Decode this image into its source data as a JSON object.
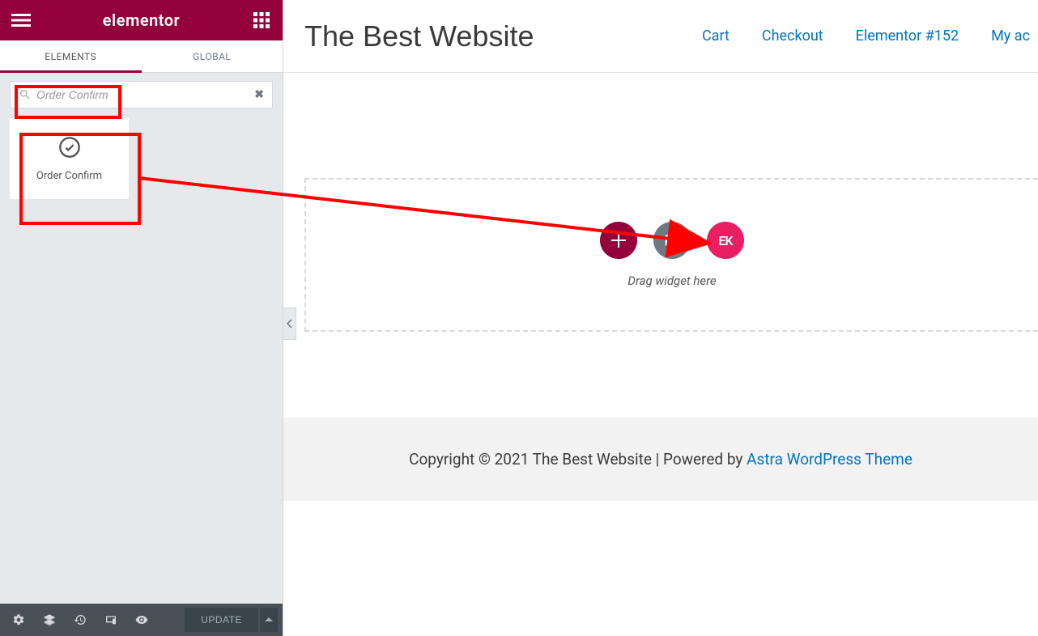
{
  "sidebar": {
    "logo": "elementor",
    "tabs": {
      "elements": "ELEMENTS",
      "global": "GLOBAL"
    },
    "search": {
      "value": "Order Confirm",
      "clear_glyph": "✖"
    },
    "widget": {
      "label": "Order Confirm"
    },
    "footer": {
      "update_label": "UPDATE"
    }
  },
  "preview": {
    "site_title": "The Best Website",
    "nav": [
      {
        "label": "Cart"
      },
      {
        "label": "Checkout"
      },
      {
        "label": "Elementor #152"
      },
      {
        "label": "My ac"
      }
    ],
    "drag_hint": "Drag widget here",
    "add_buttons": {
      "ek_label": "EK"
    },
    "footer_text": "Copyright © 2021 The Best Website | Powered by ",
    "footer_link": "Astra WordPress Theme"
  }
}
